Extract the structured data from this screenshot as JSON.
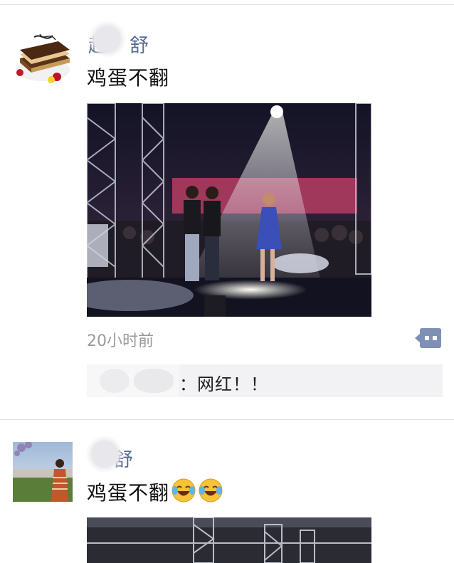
{
  "posts": [
    {
      "author_visible": "赵 舒",
      "author_left": "赵",
      "author_right": "舒",
      "text": "鸡蛋不翻",
      "time": "20小时前",
      "comment": {
        "text": "：网红！！"
      },
      "photo_desc": "stage-spotlight-performance"
    },
    {
      "author_visible": "舒",
      "author_left": "",
      "author_right": "舒",
      "text": "鸡蛋不翻",
      "emojis": [
        "face-with-tears-of-joy",
        "face-with-tears-of-joy"
      ],
      "photo_desc": "stage-truss-structure"
    }
  ],
  "colors": {
    "name": "#576b95",
    "time": "#9b9b9b",
    "comment_bg": "#f2f2f4",
    "more_btn": "#7e91b5"
  },
  "icons": {
    "more": "more-dots-icon"
  }
}
